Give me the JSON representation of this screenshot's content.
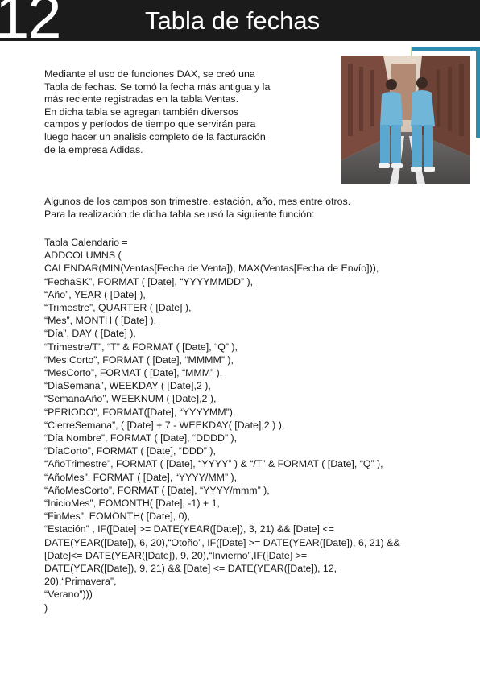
{
  "header": {
    "page_number": "12",
    "title": "Tabla de fechas"
  },
  "intro_lines": [
    "Mediante el uso de funciones DAX, se creó una",
    "Tabla de fechas. Se tomó la fecha más antigua y la",
    "más reciente registradas en la tabla Ventas.",
    "En dicha tabla se agregan también diversos",
    "campos y períodos de tiempo que servirán para",
    "luego hacer un analisis completo de la facturación",
    "de la empresa Adidas."
  ],
  "paragraph2_lines": [
    "Algunos de los campos son trimestre, estación, año, mes entre otros.",
    "Para la realización de dicha tabla se usó la siguiente función:"
  ],
  "code_lines": [
    "Tabla Calendario =",
    "ADDCOLUMNS (",
    "CALENDAR(MIN(Ventas[Fecha de Venta]), MAX(Ventas[Fecha de Envío])),",
    "“FechaSK”, FORMAT ( [Date], “YYYYMMDD” ),",
    "“Año”, YEAR ( [Date] ),",
    "“Trimestre”, QUARTER ( [Date] ),",
    "“Mes”, MONTH ( [Date] ),",
    "“Día”, DAY ( [Date] ),",
    "“Trimestre/T”, “T” & FORMAT ( [Date], “Q” ),",
    "“Mes Corto”, FORMAT ( [Date], “MMMM” ),",
    "“MesCorto”, FORMAT ( [Date], “MMM” ),",
    "“DíaSemana”, WEEKDAY ( [Date],2 ),",
    "“SemanaAño”, WEEKNUM ( [Date],2 ),",
    "“PERIODO”, FORMAT([Date], “YYYYMM”),",
    "“CierreSemana”, ( [Date] + 7 - WEEKDAY( [Date],2 ) ),",
    "“Día Nombre”, FORMAT ( [Date], “DDDD” ),",
    "“DíaCorto”, FORMAT ( [Date], “DDD” ),",
    "“AñoTrimestre”, FORMAT ( [Date], “YYYY” ) & “/T” & FORMAT ( [Date], “Q” ),",
    "“AñoMes”, FORMAT ( [Date], “YYYY/MM” ),",
    "“AñoMesCorto”, FORMAT ( [Date], “YYYY/mmm” ),",
    "“InicioMes”, EOMONTH( [Date], -1) + 1,",
    "“FinMes”, EOMONTH( [Date], 0),",
    "“Estación” , IF([Date] >= DATE(YEAR([Date]), 3, 21) && [Date] <=",
    "DATE(YEAR([Date]), 6, 20),“Otoño”, IF([Date] >= DATE(YEAR([Date]), 6, 21) &&",
    "[Date]<= DATE(YEAR([Date]), 9, 20),“Invierno”,IF([Date] >=",
    "DATE(YEAR([Date]), 9, 21) && [Date] <= DATE(YEAR([Date]), 12,",
    "20),“Primavera”,",
    "“Verano”)))",
    ")"
  ],
  "colors": {
    "header_bg": "#1b1b1b",
    "frame_accent": "#2f8cae",
    "text": "#1a1a1a"
  }
}
